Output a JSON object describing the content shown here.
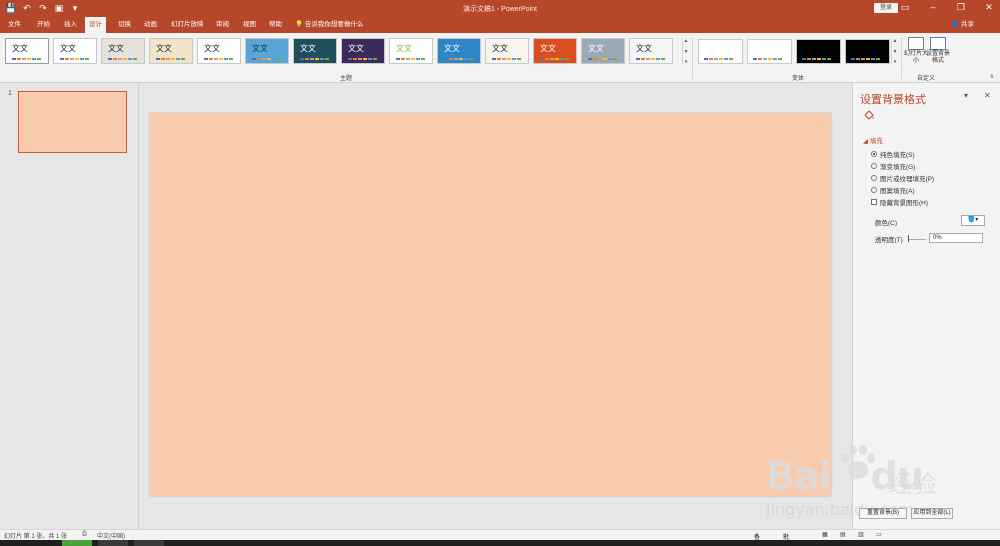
{
  "titlebar": {
    "quick_access": [
      "save-icon",
      "undo-icon",
      "redo-icon",
      "start-from-beginning-icon",
      "customize-icon"
    ],
    "doc_title": "演示文稿1  -  PowerPoint",
    "login_label": "登录",
    "window_controls": [
      "ribbon-display-icon",
      "minimize-icon",
      "restore-icon",
      "close-icon"
    ]
  },
  "tabs": {
    "items": [
      "文件",
      "开始",
      "插入",
      "设计",
      "切换",
      "动画",
      "幻灯片放映",
      "审阅",
      "视图",
      "帮助"
    ],
    "active": "设计",
    "tell_me": "告诉我你想要做什么",
    "share": "共享"
  },
  "ribbon": {
    "themes_group_label": "主题",
    "variants_group_label": "变体",
    "customize_group_label": "自定义",
    "theme_sample_text": "文文",
    "themes": [
      {
        "bg": "#ffffff",
        "fg": "#262626"
      },
      {
        "bg": "#ffffff",
        "fg": "#262626"
      },
      {
        "bg": "#e7e1dc",
        "fg": "#262626"
      },
      {
        "bg": "#f2e4c9",
        "fg": "#262626"
      },
      {
        "bg": "#ffffff",
        "fg": "#262626"
      },
      {
        "bg": "#5aa5d8",
        "fg": "#103050"
      },
      {
        "bg": "#1f4e5c",
        "fg": "#ffffff"
      },
      {
        "bg": "#3b2a5a",
        "fg": "#ffffff"
      },
      {
        "bg": "#ffffff",
        "fg": "#7fb93f"
      },
      {
        "bg": "#2d86c8",
        "fg": "#ffffff"
      },
      {
        "bg": "#f7f5ee",
        "fg": "#262626"
      },
      {
        "bg": "#d94f1f",
        "fg": "#ffffff"
      },
      {
        "bg": "#9aa9b3",
        "fg": "#ffffff"
      },
      {
        "bg": "#f6f6f6",
        "fg": "#262626"
      }
    ],
    "variants": [
      {
        "bg": "#ffffff"
      },
      {
        "bg": "#ffffff"
      },
      {
        "bg": "#000000"
      },
      {
        "bg": "#000000"
      }
    ],
    "slide_size_label": "幻灯片大小",
    "format_bg_label": "设置背景格式"
  },
  "thumbnails": {
    "slide_number": "1"
  },
  "slide": {
    "background_color": "#f8cbad"
  },
  "format_pane": {
    "title": "设置背景格式",
    "section_fill": "填充",
    "options": [
      {
        "label": "纯色填充(S)",
        "selected": true
      },
      {
        "label": "渐变填充(G)",
        "selected": false
      },
      {
        "label": "图片或纹理填充(P)",
        "selected": false
      },
      {
        "label": "图案填充(A)",
        "selected": false
      }
    ],
    "hide_bg_graphics": "隐藏背景图形(H)",
    "color_label": "颜色(C)",
    "transparency_label": "透明度(T)",
    "transparency_value": "0%",
    "reset_button": "重置背景(B)",
    "apply_all_button": "应用到全部(L)"
  },
  "statusbar": {
    "slide_info": "幻灯片 第 1 张，共 1 张",
    "language": "中文(中国)",
    "notes": "备注",
    "comments": "批注"
  },
  "watermark": {
    "brand_latin": "Bai",
    "brand_du": "du",
    "brand_cn": "经验",
    "url": "jingyan.baidu.com"
  },
  "colors": {
    "accent": "#b7472a",
    "slide_bg": "#f8cbad",
    "thumb_border": "#d9563c"
  }
}
